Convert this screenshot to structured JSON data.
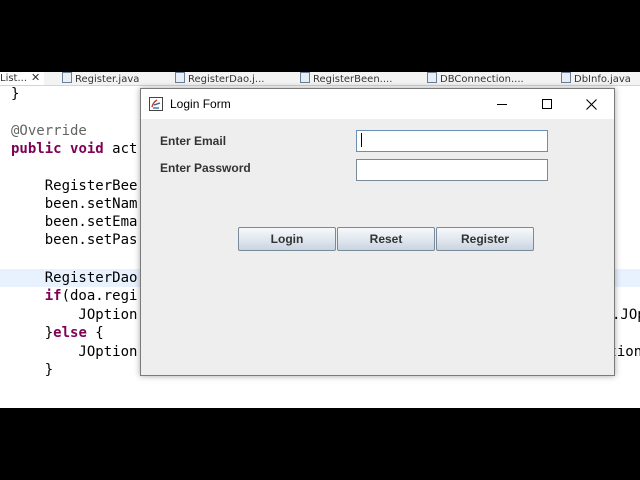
{
  "editor": {
    "tabs": [
      {
        "label": "List...",
        "close": "✕",
        "active": true
      },
      {
        "label": "Register.java"
      },
      {
        "label": "RegisterDao.j..."
      },
      {
        "label": "RegisterBeen...."
      },
      {
        "label": "DBConnection...."
      },
      {
        "label": "DbInfo.java"
      }
    ],
    "lines": [
      {
        "text": "}"
      },
      {
        "text": ""
      },
      {
        "text": "@Override"
      },
      {
        "text_kw1": "public",
        "text_kw2": "void",
        "text_rest": "act"
      },
      {
        "text": ""
      },
      {
        "text": "    RegisterBee"
      },
      {
        "text": "    been.setNam"
      },
      {
        "text": "    been.setEma"
      },
      {
        "text": "    been.setPas"
      },
      {
        "text": ""
      },
      {
        "text": "    RegisterDao"
      },
      {
        "kw": "if",
        "rest": "(doa.regi"
      },
      {
        "text": "        JOption",
        "right": ".JOp"
      },
      {
        "pre": "}",
        "kw": "else",
        "rest": " {"
      },
      {
        "text": "        JOption",
        "right": "ption"
      },
      {
        "text": "    }"
      }
    ]
  },
  "window": {
    "title": "Login Form",
    "controls": {
      "minimize": "minimize",
      "maximize": "maximize",
      "close": "close"
    },
    "email_label": "Enter Email",
    "email_value": "",
    "password_label": "Enter Password",
    "password_value": "",
    "buttons": {
      "login": "Login",
      "reset": "Reset",
      "register": "Register"
    }
  },
  "colors": {
    "keyword": "#7f0055",
    "annotation": "#646464",
    "button_border": "#7a8a99",
    "window_bg": "#eeeeee"
  }
}
